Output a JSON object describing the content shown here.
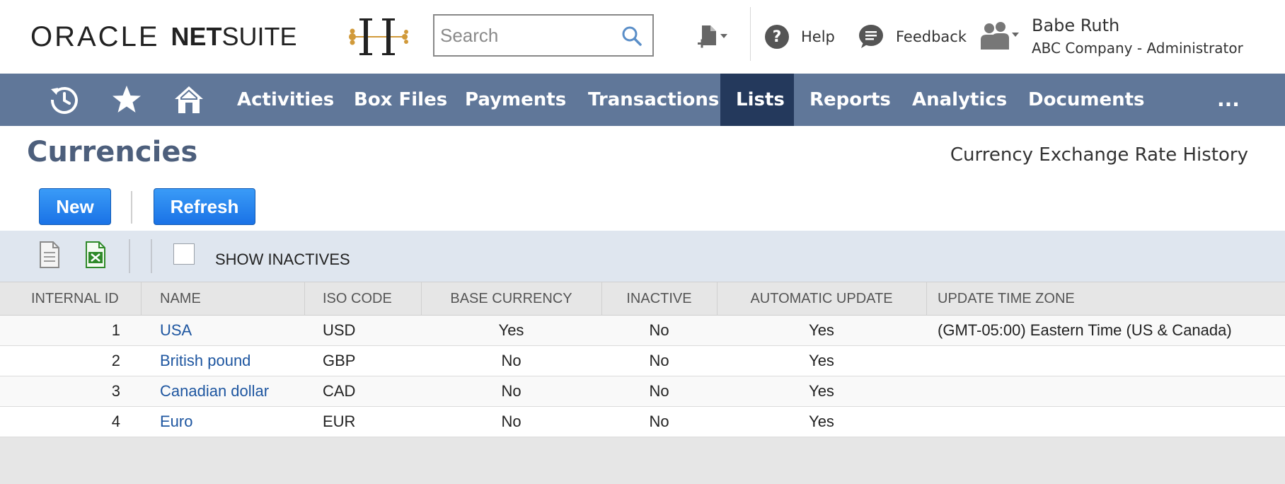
{
  "header": {
    "logo_oracle": "ORACLE",
    "logo_net": "NET",
    "logo_suite": "SUITE",
    "search_placeholder": "Search",
    "help_label": "Help",
    "feedback_label": "Feedback",
    "user_name": "Babe Ruth",
    "user_role": "ABC Company - Administrator"
  },
  "nav": {
    "items": [
      "Activities",
      "Box Files",
      "Payments",
      "Transactions",
      "Lists",
      "Reports",
      "Analytics",
      "Documents"
    ],
    "active": "Lists",
    "more": "..."
  },
  "page": {
    "title": "Currencies",
    "rate_history_link": "Currency Exchange Rate History",
    "new_button": "New",
    "refresh_button": "Refresh",
    "show_inactives_label": "SHOW INACTIVES",
    "show_inactives_checked": false
  },
  "table": {
    "columns": [
      "INTERNAL ID",
      "NAME",
      "ISO CODE",
      "BASE CURRENCY",
      "INACTIVE",
      "AUTOMATIC UPDATE",
      "UPDATE TIME ZONE"
    ],
    "rows": [
      {
        "id": "1",
        "name": "USA",
        "iso": "USD",
        "base": "Yes",
        "inactive": "No",
        "auto": "Yes",
        "tz": "(GMT-05:00) Eastern Time (US & Canada)"
      },
      {
        "id": "2",
        "name": "British pound",
        "iso": "GBP",
        "base": "No",
        "inactive": "No",
        "auto": "Yes",
        "tz": ""
      },
      {
        "id": "3",
        "name": "Canadian dollar",
        "iso": "CAD",
        "base": "No",
        "inactive": "No",
        "auto": "Yes",
        "tz": ""
      },
      {
        "id": "4",
        "name": "Euro",
        "iso": "EUR",
        "base": "No",
        "inactive": "No",
        "auto": "Yes",
        "tz": ""
      }
    ]
  },
  "colors": {
    "nav_bg": "#607799",
    "nav_active": "#24395c",
    "title": "#4d5f7c",
    "button": "#1a72e6",
    "link": "#1e56a0",
    "toolbar_bg": "#dfe6ef"
  },
  "icons": {
    "search": "search-icon",
    "add_new": "new-record-icon",
    "help": "help-icon",
    "feedback": "feedback-icon",
    "user": "user-group-icon",
    "recent": "recent-records-icon",
    "star": "shortcuts-star-icon",
    "home": "home-icon",
    "print": "document-print-icon",
    "excel": "excel-export-icon"
  }
}
